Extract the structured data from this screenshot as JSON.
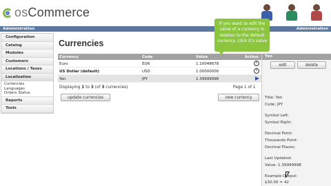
{
  "header": {
    "logo_os": "os",
    "logo_text": "Commerce",
    "nav_left": "Administration",
    "nav_right": "Administration"
  },
  "sidebar": {
    "items": [
      {
        "label": "Configuration"
      },
      {
        "label": "Catalog"
      },
      {
        "label": "Modules"
      },
      {
        "label": "Customers"
      },
      {
        "label": "Locations / Taxes"
      },
      {
        "label": "Localization"
      }
    ],
    "sub_items": [
      "Currencies",
      "Languages",
      "Orders Status"
    ],
    "bottom_items": [
      {
        "label": "Reports"
      },
      {
        "label": "Tools"
      }
    ]
  },
  "page": {
    "title": "Currencies"
  },
  "table": {
    "headers": {
      "currency": "Currency",
      "code": "Code",
      "value": "Value",
      "action": "Action"
    },
    "rows": [
      {
        "currency": "Euro",
        "code": "EUR",
        "value": "1.10048678"
      },
      {
        "currency": "US Dollar (default)",
        "code": "USD",
        "value": "1.00000000"
      },
      {
        "currency": "Yen",
        "code": "JPY",
        "value": "1.39999998"
      }
    ]
  },
  "pager": {
    "prefix": "Displaying ",
    "from": "1",
    "mid1": " to ",
    "to": "3",
    "mid2": " (of ",
    "total": "3",
    "suffix": " currencies)",
    "page_text": "Page 1 of 1"
  },
  "buttons": {
    "update": "update currencies",
    "new": "new currency",
    "edit": "edit",
    "delete": "delete"
  },
  "panel": {
    "header": "Yen",
    "lines": [
      "Title: Yen",
      "Code: JPY",
      "Symbol Left:",
      "Symbol Right:",
      "Decimal Point:",
      "Thousands Point:",
      "Decimal Places:",
      "Last Updated:",
      "Value: 1.39999998",
      "Example Output:",
      "$30.00 = 42"
    ]
  },
  "tooltip": {
    "text": "If you want to edit the value of a currency in relation to the default currency, click it's value"
  },
  "colors": {
    "nav_bar": "#5b78a0",
    "tooltip": "#8cc63e",
    "table_header": "#a2a2a2"
  }
}
